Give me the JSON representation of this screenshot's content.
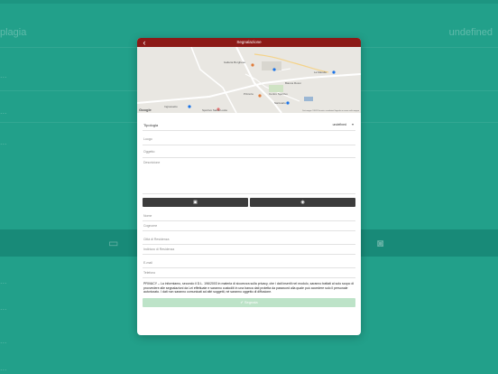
{
  "background": {
    "left_title": "plagia",
    "right_value": "undefined",
    "rows": [
      "...",
      "...",
      "...",
      "...",
      "...",
      "...",
      "...",
      "..."
    ]
  },
  "modal": {
    "title": "Segnalazione",
    "map": {
      "places": [
        "Galleria Borghese",
        "Bianca Rossi",
        "La Marelle",
        "Centro Sportivo",
        "Santuario",
        "Ingrassetto",
        "Pizzeria",
        "Sportivo Santa Lucia"
      ],
      "google": "Google",
      "attribution": "Dati mappa ©2023  Termini e condizioni  Segnala un errore nella mappa"
    },
    "form": {
      "tipologia_label": "Tipologia",
      "tipologia_value": "undefined",
      "luogo_placeholder": "Luogo",
      "oggetto_placeholder": "Oggetto",
      "descrizione_placeholder": "Descrizione",
      "gallery_icon": "image-icon",
      "camera_icon": "camera-icon",
      "nome_placeholder": "Nome",
      "cognome_placeholder": "Cognome",
      "citta_placeholder": "Città di Residenza",
      "indirizzo_placeholder": "Indirizzo di Residenza",
      "email_placeholder": "E-mail",
      "telefono_placeholder": "Telefono",
      "privacy": "PRIVACY – La informiamo, secondo il D.L. 196/2003 in materia di sicurezza sulla privacy, che i dati inseriti nel modulo, saranno trattati al solo scopo di provvedere alle segnalazioni da Lei effettuate e saranno custoditi in una banca dati protetta da password alla quale può accedere solo il personale autorizzato. I dati non saranno comunicati ad altri soggetti, né saranno oggetto di diffusione.",
      "submit_label": "Segnala"
    }
  }
}
